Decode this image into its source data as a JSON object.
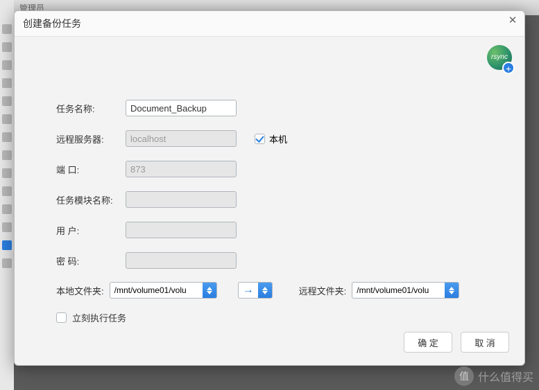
{
  "bg_header": "管理员",
  "dialog": {
    "title": "创建备份任务",
    "badge_text": "rsync"
  },
  "form": {
    "task_name": {
      "label": "任务名称:",
      "value": "Document_Backup"
    },
    "remote_server": {
      "label": "远程服务器:",
      "value": "localhost"
    },
    "local_machine_label": "本机",
    "port": {
      "label": "端 口:",
      "value": "873"
    },
    "module": {
      "label": "任务模块名称:",
      "value": ""
    },
    "user": {
      "label": "用 户:",
      "value": ""
    },
    "password": {
      "label": "密 码:",
      "value": ""
    },
    "local_folder": {
      "label": "本地文件夹:",
      "value": "/mnt/volume01/volu"
    },
    "direction": "→",
    "remote_folder": {
      "label": "远程文件夹:",
      "value": "/mnt/volume01/volu"
    },
    "run_now_label": "立刻执行任务"
  },
  "buttons": {
    "ok": "确 定",
    "cancel": "取 消"
  },
  "watermark": {
    "badge": "值",
    "text": "什么值得买"
  }
}
